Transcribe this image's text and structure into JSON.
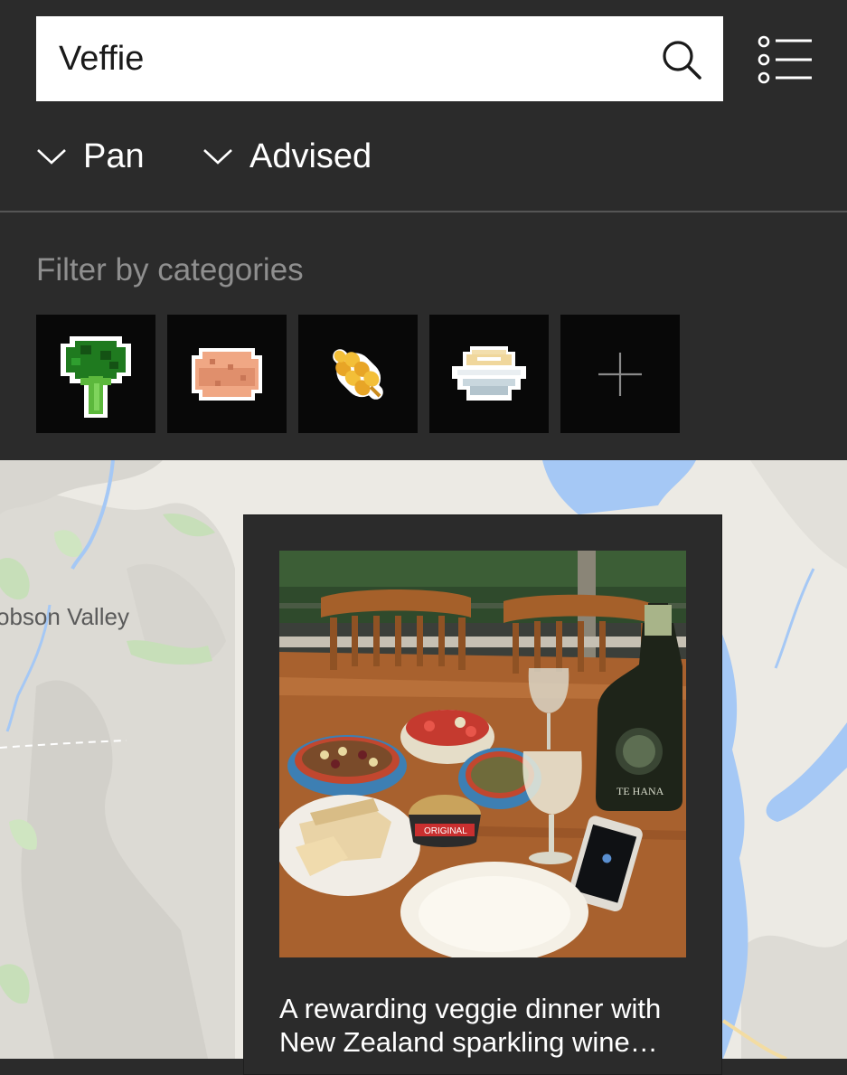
{
  "search": {
    "value": "Veffie"
  },
  "filters": {
    "dropdowns": [
      {
        "label": "Pan"
      },
      {
        "label": "Advised"
      }
    ]
  },
  "categories": {
    "title": "Filter by categories",
    "tiles": [
      {
        "icon": "broccoli-icon"
      },
      {
        "icon": "meat-patty-icon"
      },
      {
        "icon": "wheat-grain-icon"
      },
      {
        "icon": "dessert-bowl-icon"
      },
      {
        "icon": "plus-icon"
      }
    ]
  },
  "map": {
    "place_label": "obson Valley"
  },
  "post": {
    "caption_line1": "A rewarding veggie dinner with",
    "caption_line2": "New Zealand sparkling wine…",
    "bottle_label": "TE HANA",
    "tub_label": "ORIGINAL"
  },
  "colors": {
    "panel": "#2b2b2b",
    "tile": "#080808",
    "water": "#a5c8f5",
    "map_land": "#eceae4"
  }
}
